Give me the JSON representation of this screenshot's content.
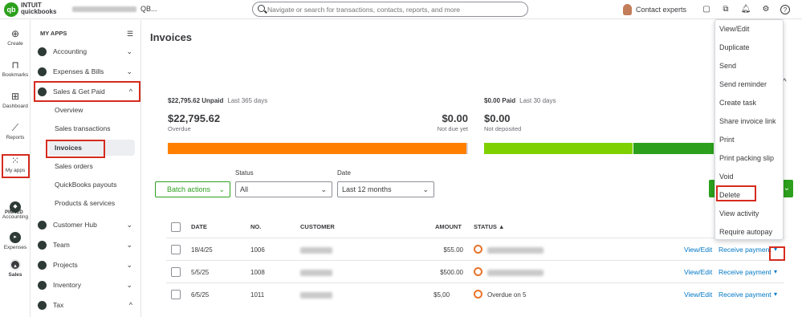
{
  "topbar": {
    "logo_glyph": "qb",
    "brand_line1": "INTUIT",
    "brand_line2": "quickbooks",
    "company_suffix": "QB...",
    "search_placeholder": "Navigate or search for transactions, contacts, reports, and more",
    "contact_experts": "Contact experts",
    "icons": [
      "tasks-icon",
      "apps-icon",
      "bell-icon",
      "gear-icon",
      "help-icon"
    ]
  },
  "rail": {
    "items": [
      {
        "label": "Create",
        "icon": "plus-icon",
        "glyph": "⊕"
      },
      {
        "label": "Bookmarks",
        "icon": "bookmark-icon",
        "glyph": "⊓"
      },
      {
        "label": "Dashboard",
        "icon": "dashboard-icon",
        "glyph": "⊞"
      },
      {
        "label": "Reports",
        "icon": "reports-icon",
        "glyph": "⟋"
      },
      {
        "label": "My apps",
        "icon": "grid-icon",
        "glyph": "⁙"
      }
    ],
    "pinned_label": "PINNED",
    "pinned": [
      {
        "label": "Accounting"
      },
      {
        "label": "Expenses"
      },
      {
        "label": "Sales"
      }
    ]
  },
  "sidebar": {
    "title": "MY APPS",
    "apps": [
      {
        "label": "Accounting",
        "chevron": "⌄"
      },
      {
        "label": "Expenses & Bills",
        "chevron": "⌄"
      },
      {
        "label": "Sales & Get Paid",
        "chevron": "^"
      }
    ],
    "subitems": [
      "Overview",
      "Sales transactions",
      "Invoices",
      "Sales orders",
      "QuickBooks payouts",
      "Products & services"
    ],
    "apps2": [
      {
        "label": "Customer Hub",
        "chevron": "⌄"
      },
      {
        "label": "Team",
        "chevron": "⌄"
      },
      {
        "label": "Projects",
        "chevron": "⌄"
      },
      {
        "label": "Inventory",
        "chevron": "⌄"
      },
      {
        "label": "Tax",
        "chevron": "^"
      }
    ]
  },
  "page": {
    "title": "Invoices",
    "unpaid": {
      "amount_label": "$22,795.62 Unpaid",
      "period": "Last 365 days",
      "overdue_value": "$22,795.62",
      "overdue_label": "Overdue",
      "not_due_value": "$0.00",
      "not_due_label": "Not due yet"
    },
    "paid": {
      "amount_label": "$0.00 Paid",
      "period": "Last 30 days",
      "not_deposited_value": "$0.00",
      "not_deposited_label": "Not deposited"
    },
    "colors": {
      "overdue": "#ff8000",
      "not_due": "#d4d7dc",
      "not_deposited": "#7fd000",
      "deposited": "#2ca01c"
    },
    "filters": {
      "batch_actions": "Batch actions",
      "status_label": "Status",
      "status_value": "All",
      "date_label": "Date",
      "date_value": "Last 12 months"
    },
    "table": {
      "headers": {
        "date": "DATE",
        "no": "NO.",
        "customer": "CUSTOMER",
        "amount": "AMOUNT",
        "status": "STATUS ▲"
      },
      "rows": [
        {
          "date": "18/4/25",
          "no": "1006",
          "amount": "$55.00",
          "status": "",
          "action": "Receive payment",
          "view": "View/Edit"
        },
        {
          "date": "5/5/25",
          "no": "1008",
          "amount": "$500.00",
          "status": "",
          "action": "Receive payment",
          "view": "View/Edit"
        },
        {
          "date": "6/5/25",
          "no": "1011",
          "amount": "$5,00",
          "status": "Overdue on 5",
          "action": "Receive payment",
          "view": "View/Edit"
        }
      ]
    }
  },
  "dropdown": {
    "items": [
      "View/Edit",
      "Duplicate",
      "Send",
      "Send reminder",
      "Create task",
      "Share invoice link",
      "Print",
      "Print packing slip",
      "Void",
      "Delete",
      "View activity",
      "Require autopay"
    ]
  }
}
